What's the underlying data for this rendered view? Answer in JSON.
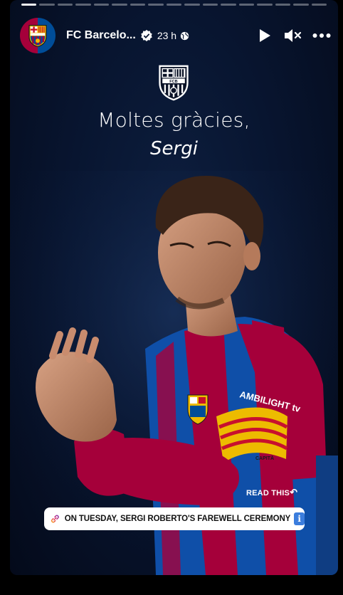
{
  "story": {
    "account_name": "FC Barcelo...",
    "time_ago": "23 h",
    "segments_total": 17,
    "segments_active": 1,
    "icons": {
      "verified": "verified-badge-icon",
      "audience": "globe-icon",
      "play": "play-icon",
      "mute": "muted-speaker-icon",
      "more": "more-dots-icon"
    }
  },
  "content": {
    "title_line1": "Moltes gràcies,",
    "title_line2": "Sergi",
    "read_this_label": "READ THIS",
    "link_sticker_text": "ON TUESDAY, SERGI ROBERTO'S FAREWELL CEREMONY",
    "info_glyph": "i",
    "armband_text": "CAPITÀ",
    "sleeve_sponsor": "AMBILIGHT tv",
    "crest_letters": "FCB"
  },
  "colors": {
    "background": "#081530",
    "blaugrana_blue": "#004d98",
    "blaugrana_red": "#a5003a",
    "crest_gold": "#edbb00",
    "sticker_bg": "#ffffff"
  }
}
